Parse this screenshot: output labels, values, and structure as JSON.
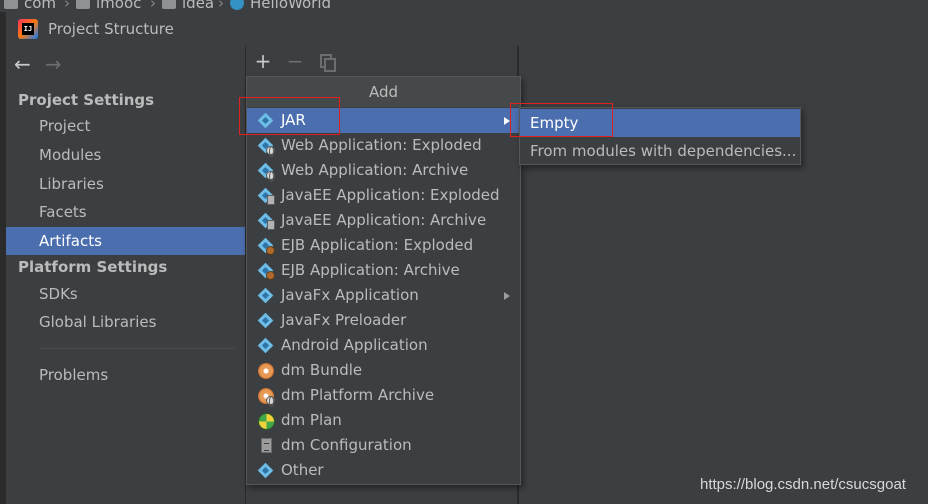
{
  "breadcrumb": {
    "items": [
      {
        "label": "com",
        "icon": "folder-icon"
      },
      {
        "label": "imooc",
        "icon": "folder-icon"
      },
      {
        "label": "idea",
        "icon": "folder-icon"
      },
      {
        "label": "HelloWorld",
        "icon": "class-icon"
      }
    ],
    "separator": "›"
  },
  "dialog": {
    "title": "Project Structure",
    "logo_text": "IJ"
  },
  "nav": {
    "back_icon": "←",
    "forward_icon": "→"
  },
  "sidebar": {
    "project_settings_header": "Project Settings",
    "project_settings_items": [
      {
        "label": "Project"
      },
      {
        "label": "Modules"
      },
      {
        "label": "Libraries"
      },
      {
        "label": "Facets"
      },
      {
        "label": "Artifacts",
        "selected": true
      }
    ],
    "platform_settings_header": "Platform Settings",
    "platform_settings_items": [
      {
        "label": "SDKs"
      },
      {
        "label": "Global Libraries"
      }
    ],
    "problems_label": "Problems"
  },
  "toolbar": {
    "add_icon": "+",
    "remove_icon": "−"
  },
  "add_menu": {
    "header": "Add",
    "items": [
      {
        "label": "JAR",
        "icon": "artifact-diamond-icon",
        "submenu": true,
        "highlighted": true
      },
      {
        "label": "Web Application: Exploded",
        "icon": "web-app-icon"
      },
      {
        "label": "Web Application: Archive",
        "icon": "web-app-icon"
      },
      {
        "label": "JavaEE Application: Exploded",
        "icon": "javaee-app-icon"
      },
      {
        "label": "JavaEE Application: Archive",
        "icon": "javaee-app-icon"
      },
      {
        "label": "EJB Application: Exploded",
        "icon": "ejb-app-icon"
      },
      {
        "label": "EJB Application: Archive",
        "icon": "ejb-app-icon"
      },
      {
        "label": "JavaFx Application",
        "icon": "artifact-diamond-icon",
        "submenu": true
      },
      {
        "label": "JavaFx Preloader",
        "icon": "artifact-diamond-icon"
      },
      {
        "label": "Android Application",
        "icon": "artifact-diamond-icon"
      },
      {
        "label": "dm Bundle",
        "icon": "dm-bundle-icon"
      },
      {
        "label": "dm Platform Archive",
        "icon": "dm-platform-archive-icon"
      },
      {
        "label": "dm Plan",
        "icon": "dm-plan-icon"
      },
      {
        "label": "dm Configuration",
        "icon": "dm-configuration-icon"
      },
      {
        "label": "Other",
        "icon": "artifact-diamond-icon"
      }
    ]
  },
  "jar_submenu": {
    "items": [
      {
        "label": "Empty",
        "highlighted": true
      },
      {
        "label": "From modules with dependencies..."
      }
    ]
  },
  "watermark": "https://blog.csdn.net/csucsgoat",
  "colors": {
    "background": "#3c3f41",
    "selection": "#4b6eaf",
    "annotation_red": "#e02020",
    "text": "#bbbbbb"
  }
}
